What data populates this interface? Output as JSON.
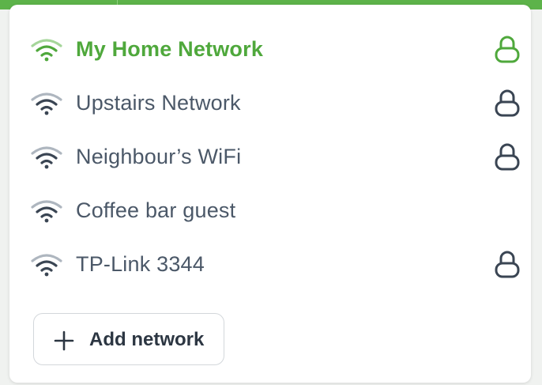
{
  "colors": {
    "accent": "#4fa83c",
    "text": "#4b5868",
    "icon": "#3a4553",
    "top_bar": "#5db34a"
  },
  "networks": [
    {
      "name": "My Home Network",
      "secured": true,
      "active": true,
      "icon": "wifi-icon"
    },
    {
      "name": "Upstairs Network",
      "secured": true,
      "active": false,
      "icon": "wifi-icon"
    },
    {
      "name": "Neighbour’s WiFi",
      "secured": true,
      "active": false,
      "icon": "wifi-icon"
    },
    {
      "name": "Coffee bar guest",
      "secured": false,
      "active": false,
      "icon": "wifi-icon"
    },
    {
      "name": "TP-Link 3344",
      "secured": true,
      "active": false,
      "icon": "wifi-icon"
    }
  ],
  "add_button": {
    "label": "Add network",
    "icon": "plus-icon"
  }
}
